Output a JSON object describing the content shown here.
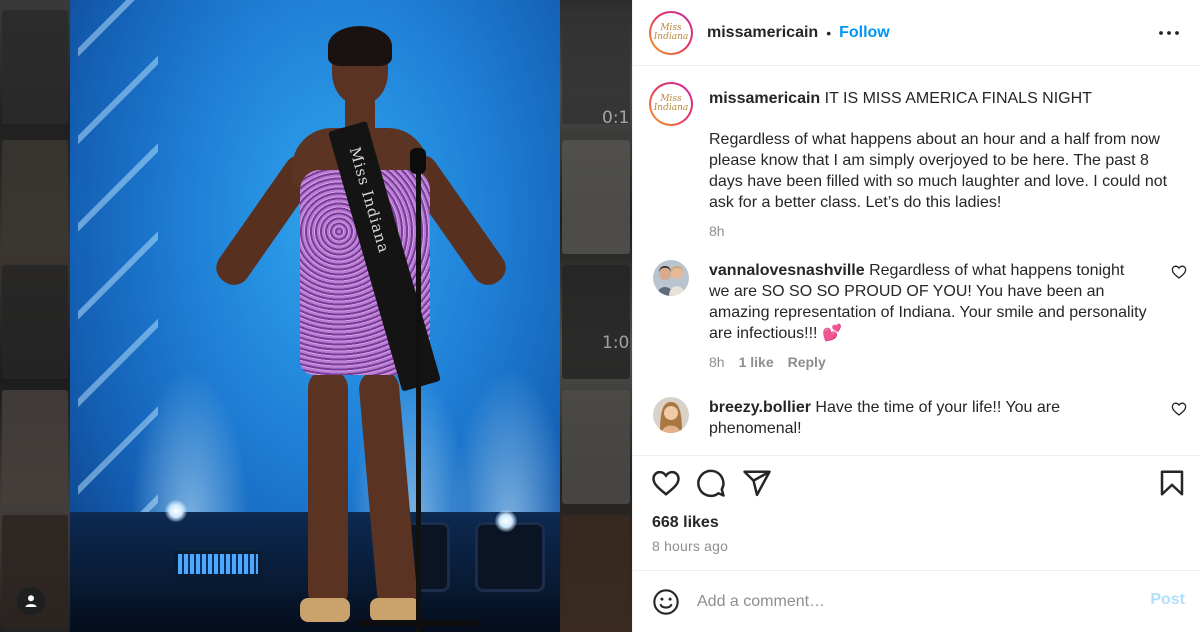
{
  "media": {
    "sash_text": "Miss Indiana",
    "timecodes": [
      "0:1",
      "1:0"
    ]
  },
  "header": {
    "logo_text": "Miss Indiana",
    "username": "missamericain",
    "separator": "•",
    "follow_label": "Follow"
  },
  "caption": {
    "username": "missamericain",
    "headline": "IT IS MISS AMERICA FINALS NIGHT",
    "body": "Regardless of what happens about an hour and a half from now please know that I am simply overjoyed to be here. The past 8 days have been filled with so much laughter and love. I could not ask for a better class. Let’s do this ladies!",
    "time": "8h"
  },
  "comments": [
    {
      "username": "vannalovesnashville",
      "text": "Regardless of what happens tonight we are SO SO SO PROUD OF YOU! You have been an amazing representation of Indiana. Your smile and personality are infectious!!! 💕",
      "time": "8h",
      "likes": "1 like",
      "reply": "Reply"
    },
    {
      "username": "breezy.bollier",
      "text": "Have the time of your life!! You are phenomenal!"
    }
  ],
  "post": {
    "likes": "668 likes",
    "time_ago": "8 hours ago"
  },
  "composer": {
    "placeholder": "Add a comment…",
    "post_label": "Post"
  },
  "icons": {
    "like": "heart-icon",
    "comment": "comment-bubble-icon",
    "share": "paper-plane-icon",
    "save": "bookmark-icon",
    "more": "ellipsis-icon",
    "emoji": "smiley-icon",
    "user_tag": "user-icon"
  },
  "colors": {
    "follow": "#0095f6",
    "post_disabled": "#b2dffc",
    "secondary_text": "#8e8e8e"
  }
}
